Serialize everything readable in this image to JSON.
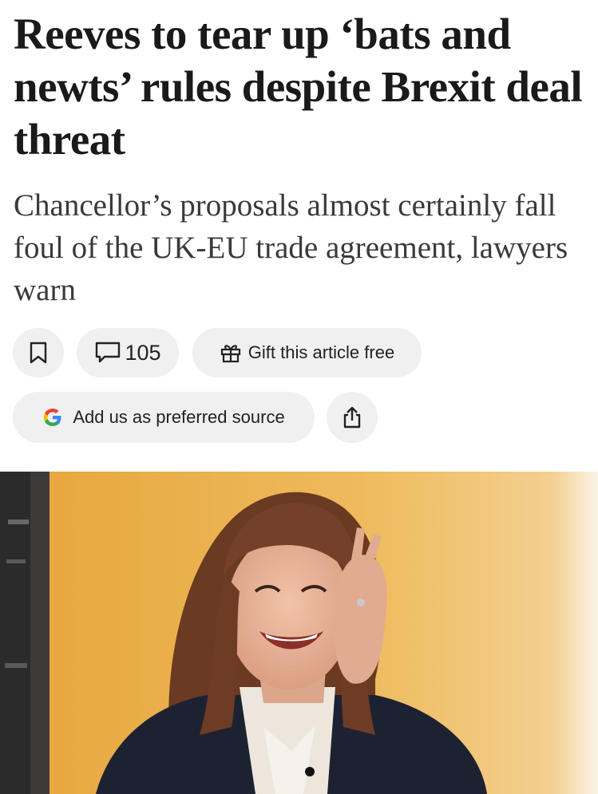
{
  "article": {
    "headline": "Reeves to tear up ‘bats and newts’ rules despite Brexit deal threat",
    "standfirst": "Chancellor’s proposals almost certainly fall foul of the UK-EU trade agreement, lawyers warn"
  },
  "actions": {
    "bookmark_icon": "bookmark-icon",
    "comment_icon": "comment-icon",
    "comment_count": "105",
    "gift_icon": "gift-icon",
    "gift_label": "Gift this article free",
    "google_icon": "google-g-icon",
    "source_label": "Add us as preferred source",
    "share_icon": "share-icon"
  },
  "hero_image": {
    "subject": "photo of a smiling woman with auburn hair touching her forehead, dark jacket, cream blouse, orange wall background"
  },
  "colors": {
    "pill_background": "#f0f0f0",
    "headline_text": "#1a1a1a",
    "standfirst_text": "#3a3a3a"
  }
}
